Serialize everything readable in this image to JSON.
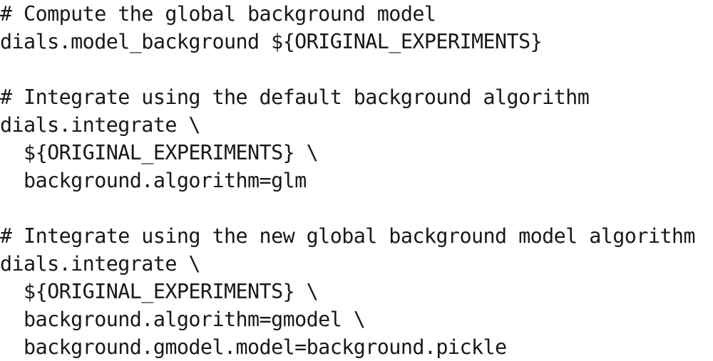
{
  "document": {
    "type": "code-listing",
    "language": "shell",
    "background_color": "#ffffff",
    "text_color": "#181818",
    "font_style": "monospace",
    "lines": [
      {
        "id": "line-1",
        "text": "# Compute the global background model",
        "kind": "comment",
        "indent": 0
      },
      {
        "id": "line-2",
        "text": "dials.model_background ${ORIGINAL_EXPERIMENTS}",
        "kind": "command",
        "indent": 0
      },
      {
        "id": "line-3",
        "text": "",
        "kind": "blank",
        "indent": 0
      },
      {
        "id": "line-4",
        "text": "# Integrate using the default background algorithm",
        "kind": "comment",
        "indent": 0
      },
      {
        "id": "line-5",
        "text": "dials.integrate \\",
        "kind": "command",
        "indent": 0
      },
      {
        "id": "line-6",
        "text": "  ${ORIGINAL_EXPERIMENTS} \\",
        "kind": "argument",
        "indent": 2
      },
      {
        "id": "line-7",
        "text": "  background.algorithm=glm",
        "kind": "argument",
        "indent": 2
      },
      {
        "id": "line-8",
        "text": "",
        "kind": "blank",
        "indent": 0
      },
      {
        "id": "line-9",
        "text": "# Integrate using the new global background model algorithm",
        "kind": "comment",
        "indent": 0
      },
      {
        "id": "line-10",
        "text": "dials.integrate \\",
        "kind": "command",
        "indent": 0
      },
      {
        "id": "line-11",
        "text": "  ${ORIGINAL_EXPERIMENTS} \\",
        "kind": "argument",
        "indent": 2
      },
      {
        "id": "line-12",
        "text": "  background.algorithm=gmodel \\",
        "kind": "argument",
        "indent": 2
      },
      {
        "id": "line-13",
        "text": "  background.gmodel.model=background.pickle",
        "kind": "argument",
        "indent": 2
      }
    ]
  }
}
